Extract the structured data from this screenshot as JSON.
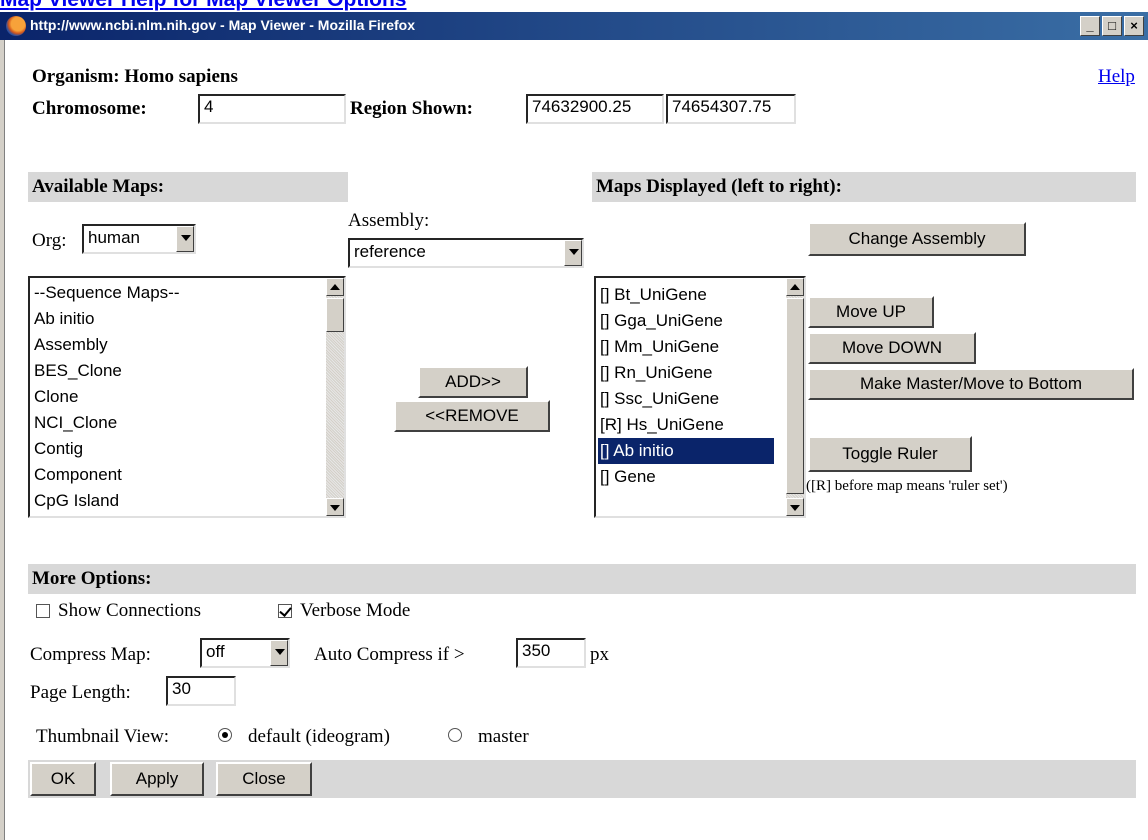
{
  "top_link": "Map Viewer Help for Map Viewer Options",
  "window": {
    "title": "http://www.ncbi.nlm.nih.gov - Map Viewer - Mozilla Firefox",
    "min_label": "_",
    "max_label": "□",
    "close_label": "×"
  },
  "organism": {
    "label": "Organism:",
    "value": "Homo sapiens"
  },
  "help": "Help",
  "chromosome": {
    "label": "Chromosome:",
    "value": "4"
  },
  "region": {
    "label": "Region Shown:",
    "start": "74632900.25",
    "end": "74654307.75"
  },
  "available": {
    "heading": "Available Maps:",
    "org_label": "Org:",
    "org_value": "human",
    "assembly_label": "Assembly:",
    "assembly_value": "reference",
    "items": [
      "--Sequence Maps--",
      "Ab initio",
      "Assembly",
      "BES_Clone",
      "Clone",
      "NCI_Clone",
      "Contig",
      "Component",
      "CpG Island"
    ]
  },
  "actions": {
    "add": "ADD>>",
    "remove": "<<REMOVE"
  },
  "displayed": {
    "heading": "Maps Displayed (left to right):",
    "items": [
      "[] Bt_UniGene",
      "[] Gga_UniGene",
      "[] Mm_UniGene",
      "[] Rn_UniGene",
      "[] Ssc_UniGene",
      "[R] Hs_UniGene",
      "[] Ab initio",
      "[] Gene"
    ],
    "selected_index": 6,
    "change_assembly": "Change Assembly",
    "move_up": "Move UP",
    "move_down": "Move DOWN",
    "make_master": "Make Master/Move to Bottom",
    "toggle_ruler": "Toggle Ruler",
    "ruler_note": "([R] before map means 'ruler set')"
  },
  "more_options": {
    "heading": "More Options:",
    "show_connections": {
      "label": "Show Connections",
      "checked": false
    },
    "verbose_mode": {
      "label": "Verbose Mode",
      "checked": true
    },
    "compress_label": "Compress Map:",
    "compress_value": "off",
    "auto_compress_label": "Auto Compress if >",
    "auto_compress_value": "350",
    "auto_compress_unit": "px",
    "page_length_label": "Page Length:",
    "page_length_value": "30",
    "thumbnail_label": "Thumbnail View:",
    "thumbnail_default": "default (ideogram)",
    "thumbnail_master": "master",
    "thumbnail_selected": "default"
  },
  "footer": {
    "ok": "OK",
    "apply": "Apply",
    "close": "Close"
  }
}
